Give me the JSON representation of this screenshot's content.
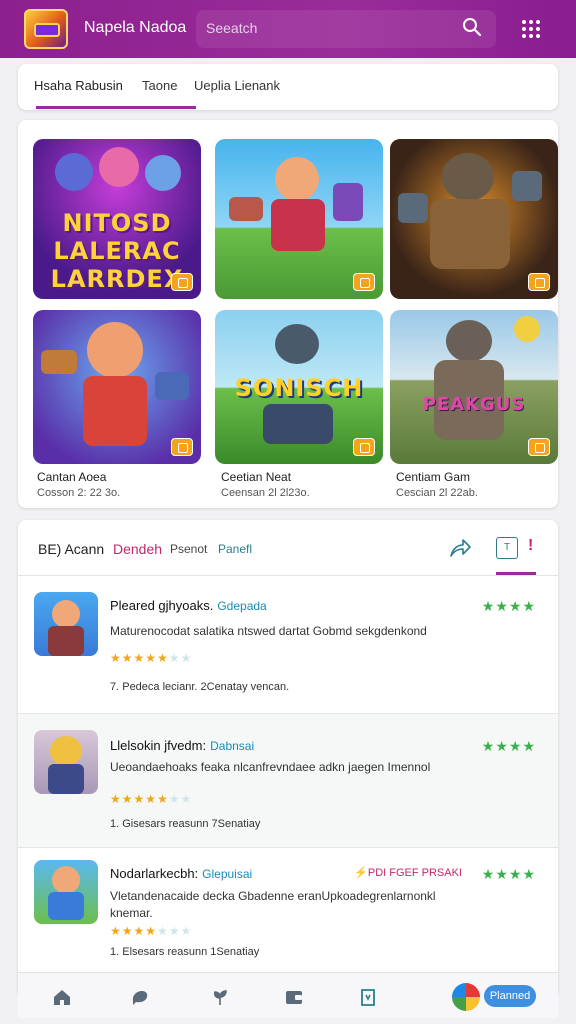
{
  "header": {
    "title": "Napela Nadoa",
    "search_placeholder": "Seeatch"
  },
  "tabs": [
    {
      "label": "Hsaha Rabusin",
      "active": true
    },
    {
      "label": "Taone",
      "active": false
    },
    {
      "label": "Ueplia Lienank",
      "active": false
    }
  ],
  "games": {
    "tiles": [
      {
        "art": "NITOSD LALERAC LARRDEX"
      },
      {
        "art": ""
      },
      {
        "art": ""
      },
      {
        "art": "",
        "caption": "Cantan Aoea",
        "sub": "Cosson 2: 22 3o."
      },
      {
        "art": "SONISCH",
        "caption": "Ceetian Neat",
        "sub": "Ceensan 2l 2l23o."
      },
      {
        "art": "PEAKGUS",
        "caption": "Centiam Gam",
        "sub": "Cescian 2l 22ab."
      }
    ]
  },
  "reviews": {
    "header": {
      "label_1": "BE) Acann",
      "label_2": "Dendeh",
      "label_3": "Psenot",
      "label_4": "Panefl",
      "book_icon_text": "T",
      "more_icon_text": "!"
    },
    "items": [
      {
        "title": "Pleared gjhyoaks.",
        "tag": "Gdepada",
        "stars_right": "★★★★",
        "body": "Maturenocodat salatika ntswed dartat Gobmd sekgdenkond",
        "stars": 5,
        "meta": "7. Pedeca lecianr. 2Cenatay vencan."
      },
      {
        "title": "Llelsokin jfvedm:",
        "tag": "Dabnsai",
        "stars_right": "★★★★",
        "body": "Ueoandaehoaks feaka nlcanfrevndaee adkn jaegen Imennol",
        "stars": 5,
        "meta": "1. Gisesars reasunn 7Senatiay"
      },
      {
        "title": "Nodarlarkecbh:",
        "tag": "Glepuisai",
        "badge": "PDI FGEF PRSAKI",
        "stars_right": "★★★★",
        "body": "Vletandenacaide decka Gbadenne eranUpkoadegrenlarnonkl knemar.",
        "stars": 4,
        "meta": "1. Elsesars reasunn 1Senatiay"
      }
    ]
  },
  "bottom_nav": {
    "planet_label": "Planned"
  },
  "colors": {
    "brand": "#9a2c9a",
    "accent_pink": "#c0286b",
    "star_gold": "#f2a51c",
    "star_green": "#3bb04a",
    "teal": "#2a7e8a"
  }
}
